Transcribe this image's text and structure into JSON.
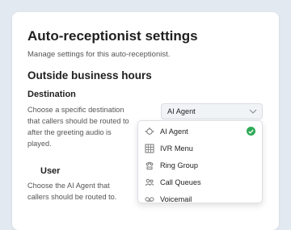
{
  "header": {
    "title": "Auto-receptionist settings",
    "subtitle": "Manage settings for this auto-receptionist."
  },
  "section": {
    "title": "Outside business hours"
  },
  "destination": {
    "label": "Destination",
    "description": "Choose a specific destination that callers should be routed to after the greeting audio is played.",
    "selected": "AI Agent",
    "options": [
      {
        "label": "AI Agent",
        "icon": "ai-agent-icon",
        "selected": true
      },
      {
        "label": "IVR Menu",
        "icon": "ivr-menu-icon",
        "selected": false
      },
      {
        "label": "Ring Group",
        "icon": "ring-group-icon",
        "selected": false
      },
      {
        "label": "Call Queues",
        "icon": "call-queues-icon",
        "selected": false
      },
      {
        "label": "Voicemail",
        "icon": "voicemail-icon",
        "selected": false
      }
    ]
  },
  "user": {
    "label": "User",
    "description": "Choose the AI Agent that callers should be routed to."
  },
  "colors": {
    "background": "#e3e9f1",
    "check": "#2eaa57"
  }
}
